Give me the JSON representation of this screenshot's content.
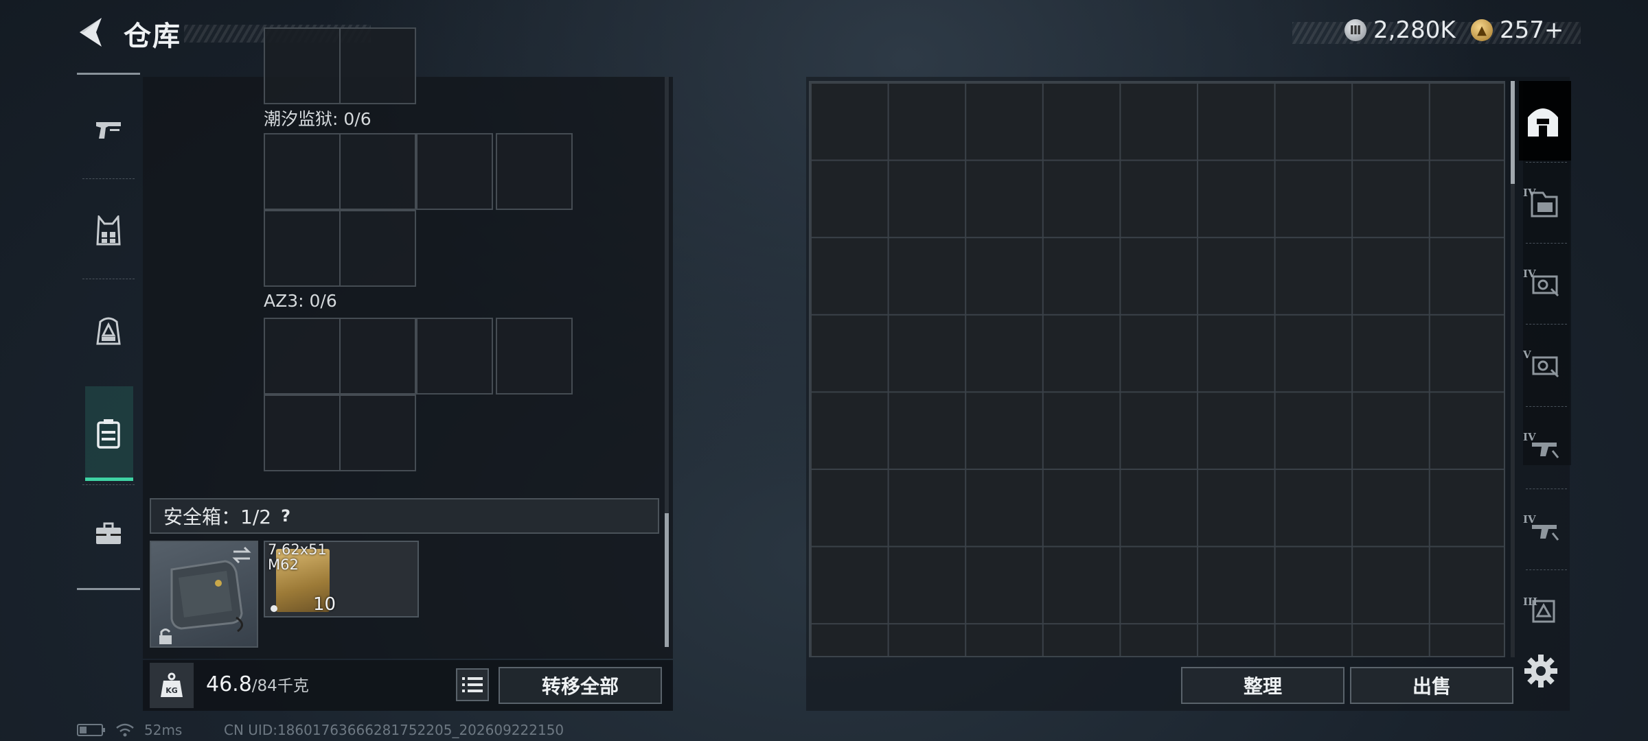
{
  "header": {
    "title": "仓库",
    "currency_silver": "2,280K",
    "currency_gold": "257+"
  },
  "left_nav": {
    "items": [
      {
        "icon": "pistol-icon"
      },
      {
        "icon": "chest-rig-icon"
      },
      {
        "icon": "backpack-icon"
      },
      {
        "icon": "safe-case-icon",
        "active": true
      },
      {
        "icon": "briefcase-icon"
      }
    ]
  },
  "loadout": {
    "slots": [
      {
        "label": "潮汐监狱: 0/6"
      },
      {
        "label": "AZ3: 0/6"
      }
    ],
    "safe_box": {
      "label": "安全箱：1/2",
      "help": "?"
    },
    "items": [
      {
        "name": "7.62x51 M62",
        "count": "10"
      }
    ]
  },
  "footer": {
    "weight_current": "46.8",
    "weight_max": "/84千克",
    "transfer_all": "转移全部"
  },
  "stash": {
    "tidy": "整理",
    "sell": "出售",
    "tabs": [
      {
        "tier": "",
        "icon": "stash-main-icon",
        "active": true
      },
      {
        "tier": "IV",
        "icon": "folder-tier-icon"
      },
      {
        "tier": "IV",
        "icon": "camera-tier-icon"
      },
      {
        "tier": "V",
        "icon": "camera-tier-icon"
      },
      {
        "tier": "IV",
        "icon": "rifle-tier-icon"
      },
      {
        "tier": "IV",
        "icon": "rifle-tier-icon"
      },
      {
        "tier": "III",
        "icon": "gear-box-tier-icon"
      }
    ]
  },
  "status": {
    "ping": "52ms",
    "uid": "CN UID:1860176366628175220‌5_202609222150"
  }
}
